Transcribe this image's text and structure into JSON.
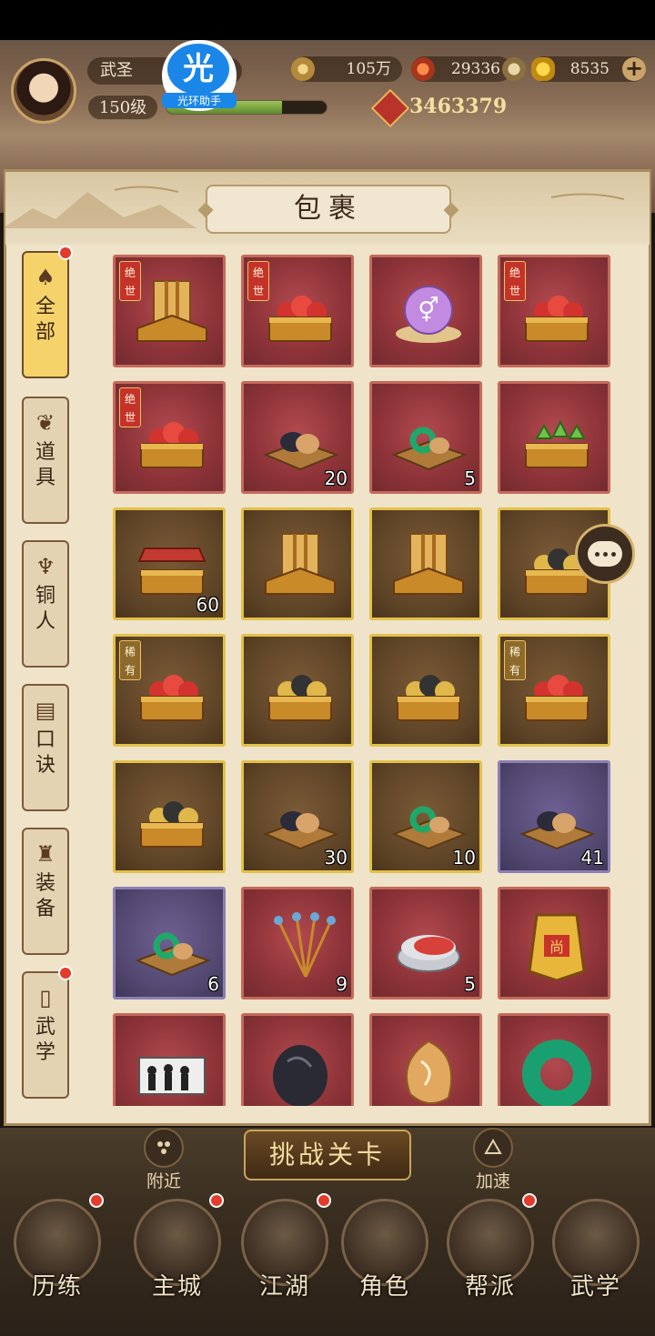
{
  "header": {
    "rank": "武圣",
    "level": "150级",
    "exp_progress": 0.72,
    "resources": [
      {
        "name": "coin",
        "value": "105万"
      },
      {
        "name": "gem",
        "value": "29336"
      },
      {
        "name": "gold-ingot",
        "value": "8535"
      }
    ],
    "power": "3463379"
  },
  "helper_badge": {
    "glyph": "光",
    "label": "光环助手"
  },
  "panel": {
    "title": "包裹"
  },
  "tabs": [
    {
      "name": "all",
      "label": "全部",
      "icon": "fan-icon",
      "active": true,
      "badge": true
    },
    {
      "name": "items",
      "label": "道具",
      "icon": "pouch-icon",
      "active": false,
      "badge": false
    },
    {
      "name": "bronze-man",
      "label": "铜人",
      "icon": "bronze-man-icon",
      "active": false,
      "badge": false
    },
    {
      "name": "formula",
      "label": "口诀",
      "icon": "scroll-icon",
      "active": false,
      "badge": false
    },
    {
      "name": "equipment",
      "label": "装备",
      "icon": "armor-icon",
      "active": false,
      "badge": false
    },
    {
      "name": "martial-arts",
      "label": "武学",
      "icon": "book-icon",
      "active": false,
      "badge": true
    }
  ],
  "items": [
    {
      "icon": "book-chest-icon",
      "quality": "red",
      "tag": "绝世",
      "count": ""
    },
    {
      "icon": "orb-chest-icon",
      "quality": "red",
      "tag": "绝世",
      "count": ""
    },
    {
      "icon": "gender-orb-icon",
      "quality": "red",
      "tag": "",
      "count": ""
    },
    {
      "icon": "orb-chest-icon",
      "quality": "red",
      "tag": "绝世",
      "count": ""
    },
    {
      "icon": "orb-chest-icon",
      "quality": "red",
      "tag": "绝世",
      "count": ""
    },
    {
      "icon": "stones-tray-icon",
      "quality": "red",
      "tag": "",
      "count": "20"
    },
    {
      "icon": "jade-tray-icon",
      "quality": "red",
      "tag": "",
      "count": "5"
    },
    {
      "icon": "green-gem-chest-icon",
      "quality": "red",
      "tag": "",
      "count": ""
    },
    {
      "icon": "scroll-chest-icon",
      "quality": "gold",
      "tag": "",
      "count": "60"
    },
    {
      "icon": "book-chest-icon",
      "quality": "gold",
      "tag": "",
      "count": ""
    },
    {
      "icon": "book-chest-icon",
      "quality": "gold",
      "tag": "",
      "count": ""
    },
    {
      "icon": "gold-orb-chest-icon",
      "quality": "gold",
      "tag": "",
      "count": ""
    },
    {
      "icon": "orb-chest-icon",
      "quality": "gold",
      "tag": "稀有",
      "count": ""
    },
    {
      "icon": "gold-orb-chest-icon",
      "quality": "gold",
      "tag": "",
      "count": ""
    },
    {
      "icon": "gold-orb-chest-icon",
      "quality": "gold",
      "tag": "",
      "count": ""
    },
    {
      "icon": "orb-chest-icon",
      "quality": "gold",
      "tag": "稀有",
      "count": ""
    },
    {
      "icon": "gold-orb-chest-icon",
      "quality": "gold",
      "tag": "",
      "count": ""
    },
    {
      "icon": "stones-tray-icon",
      "quality": "gold",
      "tag": "",
      "count": "30"
    },
    {
      "icon": "jade-tray-icon",
      "quality": "gold",
      "tag": "",
      "count": "10"
    },
    {
      "icon": "stones-tray-icon",
      "quality": "purple",
      "tag": "",
      "count": "41"
    },
    {
      "icon": "jade-tray-icon",
      "quality": "purple",
      "tag": "",
      "count": "6"
    },
    {
      "icon": "hairpins-icon",
      "quality": "red",
      "tag": "",
      "count": "9"
    },
    {
      "icon": "rouge-box-icon",
      "quality": "red",
      "tag": "",
      "count": "5"
    },
    {
      "icon": "golden-token-icon",
      "quality": "red",
      "tag": "",
      "count": ""
    },
    {
      "icon": "ink-scroll-icon",
      "quality": "red",
      "tag": "",
      "count": ""
    },
    {
      "icon": "black-stone-icon",
      "quality": "red",
      "tag": "",
      "count": ""
    },
    {
      "icon": "amber-stone-icon",
      "quality": "red",
      "tag": "",
      "count": ""
    },
    {
      "icon": "jade-ring-icon",
      "quality": "red",
      "tag": "",
      "count": ""
    }
  ],
  "bottom": {
    "nearby": "附近",
    "challenge": "挑战关卡",
    "speedup": "加速",
    "nav": [
      {
        "label": "历练",
        "icon": "training-icon",
        "badge": true
      },
      {
        "label": "主城",
        "icon": "city-icon",
        "badge": true
      },
      {
        "label": "江湖",
        "icon": "jianghu-icon",
        "badge": true
      },
      {
        "label": "角色",
        "icon": "character-icon",
        "badge": false
      },
      {
        "label": "帮派",
        "icon": "guild-icon",
        "badge": true
      },
      {
        "label": "武学",
        "icon": "martial-scroll-icon",
        "badge": false
      }
    ]
  },
  "colors": {
    "red_quality": "#8d3338",
    "gold_quality": "#e2c14a",
    "purple_quality": "#51476e",
    "badge": "#e33b2c"
  }
}
